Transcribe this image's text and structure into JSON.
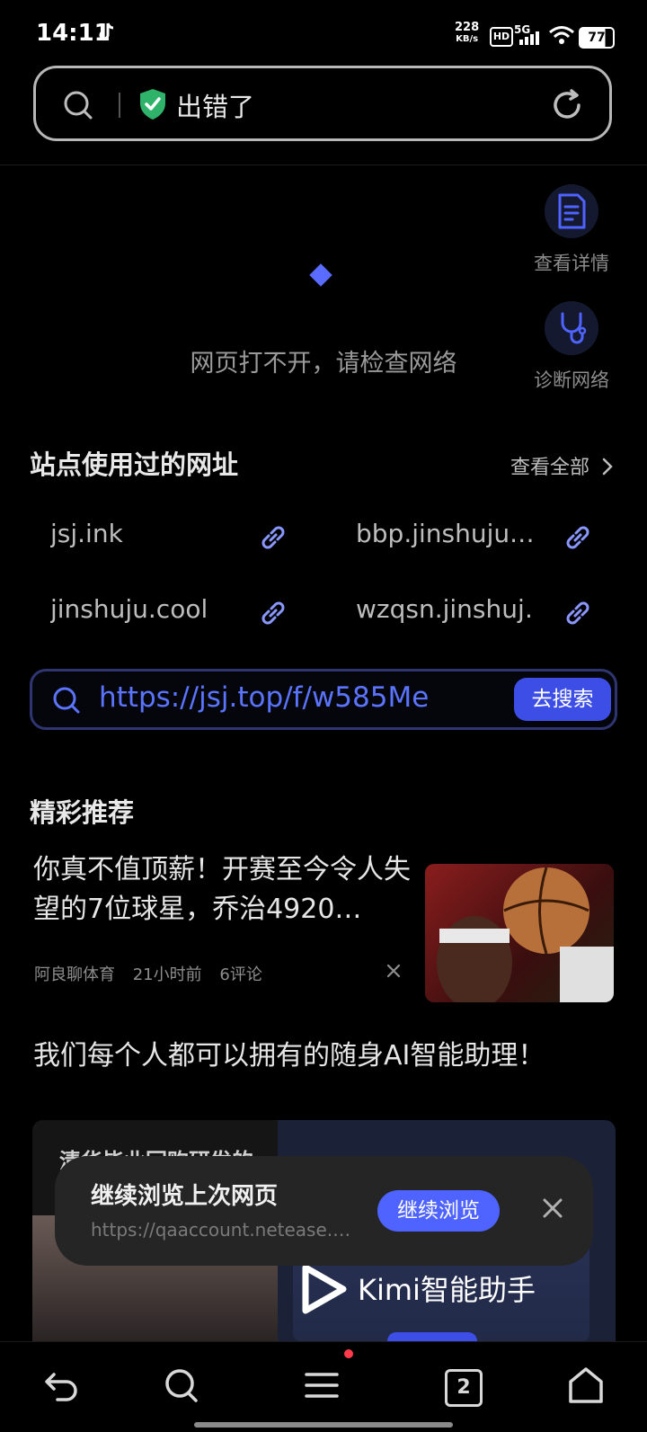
{
  "status_bar": {
    "time": "14:11",
    "speed_value": "228",
    "speed_unit": "KB/s",
    "hd": "HD",
    "network": "5G",
    "battery": "77"
  },
  "address_bar": {
    "title": "出错了"
  },
  "error": {
    "message": "网页打不开，请检查网络",
    "actions": [
      {
        "label": "查看详情",
        "icon": "document-icon"
      },
      {
        "label": "诊断网络",
        "icon": "stethoscope-icon"
      }
    ]
  },
  "history": {
    "title": "站点使用过的网址",
    "view_all": "查看全部",
    "sites": [
      "jsj.ink",
      "bbp.jinshuju.…",
      "jinshuju.cool",
      "wzqsn.jinshuj…"
    ]
  },
  "search_suggest": {
    "url": "https://jsj.top/f/w585Me",
    "button": "去搜索"
  },
  "recommend": {
    "title": "精彩推荐",
    "items": [
      {
        "title": "你真不值顶薪！开赛至今令人失望的7位球星，乔治4920…",
        "source": "阿良聊体育",
        "time": "21小时前",
        "comments": "6评论"
      },
      {
        "title": "我们每个人都可以拥有的随身AI智能助理！",
        "ad_text_left": "清华毕业回购研发的",
        "ad_brand": "Kimi智能助手"
      }
    ]
  },
  "continue_card": {
    "title": "继续浏览上次网页",
    "url": "https://qaaccount.netease.…",
    "button": "继续浏览"
  },
  "nav": {
    "tab_count": "2"
  },
  "colors": {
    "accent": "#4e63ff",
    "background": "#000000"
  }
}
